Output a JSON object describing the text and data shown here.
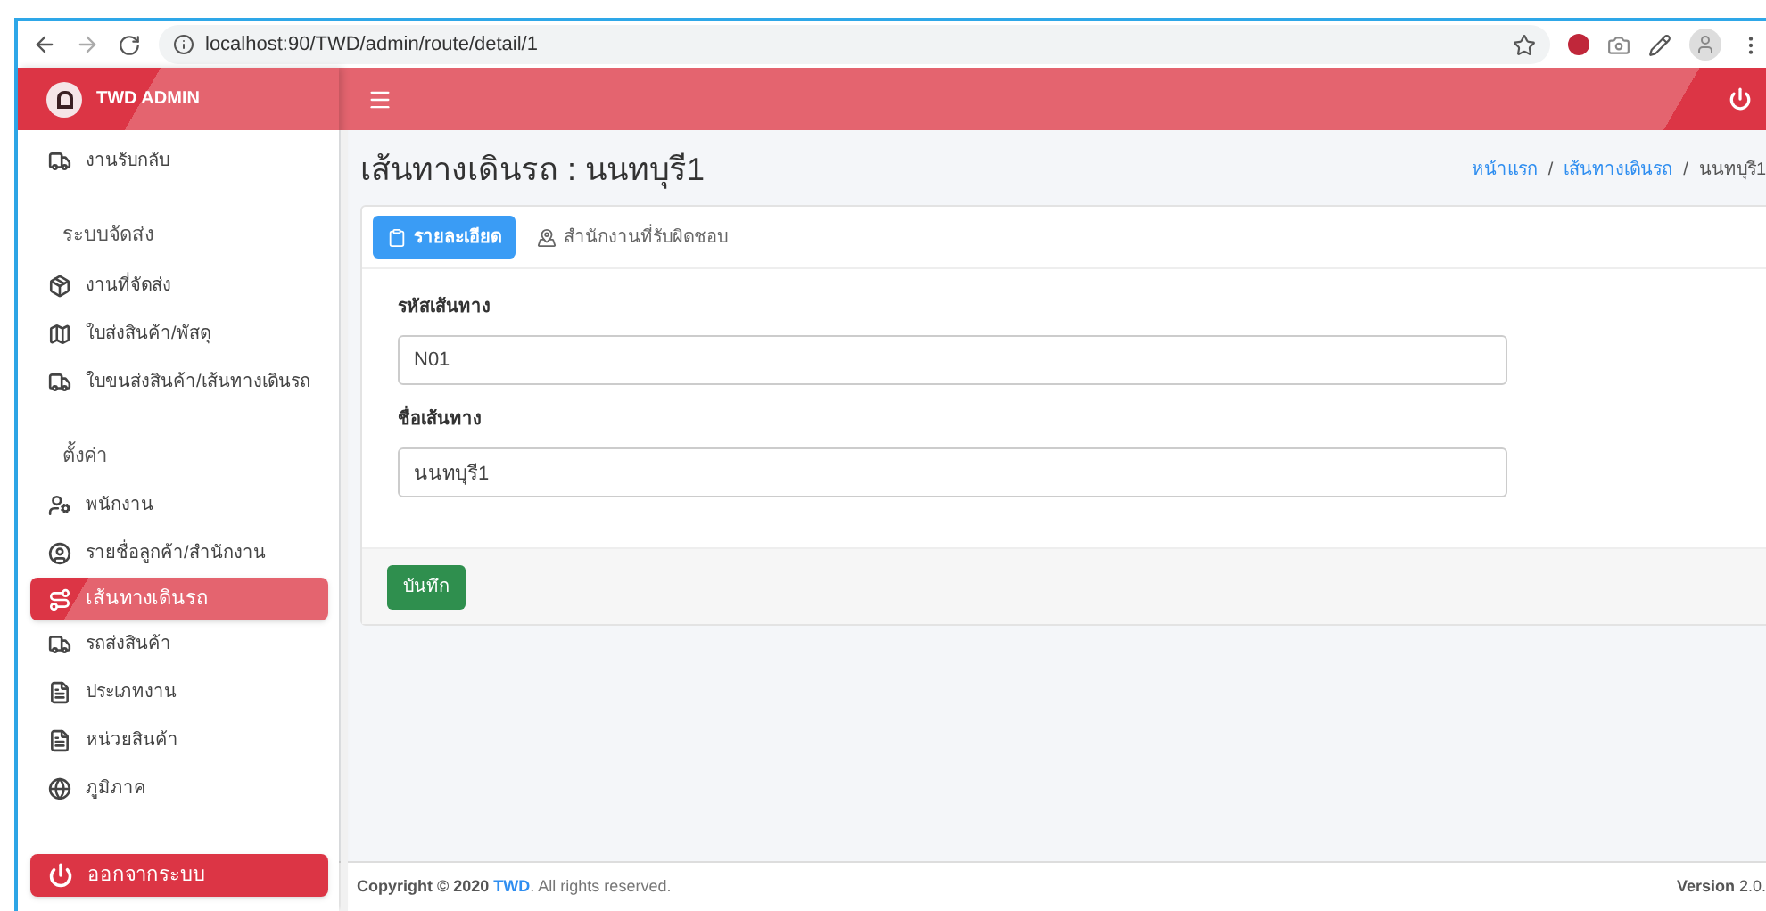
{
  "browser": {
    "url": "localhost:90/TWD/admin/route/detail/1"
  },
  "brand": {
    "title": "TWD ADMIN"
  },
  "sidebar": {
    "items": [
      {
        "kind": "item",
        "label": "งานรับกลับ",
        "selected": false
      },
      {
        "kind": "header",
        "label": "ระบบจัดส่ง"
      },
      {
        "kind": "item",
        "label": "งานที่จัดส่ง",
        "selected": false
      },
      {
        "kind": "item",
        "label": "ใบส่งสินค้า/พัสดุ",
        "selected": false
      },
      {
        "kind": "item",
        "label": "ใบขนส่งสินค้า/เส้นทางเดินรถ",
        "selected": false
      },
      {
        "kind": "header",
        "label": "ตั้งค่า"
      },
      {
        "kind": "item",
        "label": "พนักงาน",
        "selected": false
      },
      {
        "kind": "item",
        "label": "รายชื่อลูกค้า/สำนักงาน",
        "selected": false
      },
      {
        "kind": "item",
        "label": "เส้นทางเดินรถ",
        "selected": true
      },
      {
        "kind": "item",
        "label": "รถส่งสินค้า",
        "selected": false
      },
      {
        "kind": "item",
        "label": "ประเภทงาน",
        "selected": false
      },
      {
        "kind": "item",
        "label": "หน่วยสินค้า",
        "selected": false
      },
      {
        "kind": "item",
        "label": "ภูมิภาค",
        "selected": false
      }
    ],
    "logout": "ออกจากระบบ"
  },
  "page": {
    "title": "เส้นทางเดินรถ : นนทบุรี1",
    "breadcrumb": [
      {
        "label": "หน้าแรก",
        "link": true
      },
      {
        "label": "/",
        "link": false
      },
      {
        "label": "เส้นทางเดินรถ",
        "link": true
      },
      {
        "label": "/",
        "link": false
      },
      {
        "label": "นนทบุรี1",
        "link": false
      }
    ],
    "tabs": [
      {
        "label": "รายละเอียด",
        "selected": true
      },
      {
        "label": "สำนักงานที่รับผิดชอบ",
        "selected": false
      }
    ],
    "fields": [
      {
        "label": "รหัสเส้นทาง",
        "value": "N01"
      },
      {
        "label": "ชื่อเส้นทาง",
        "value": "นนทบุรี1"
      }
    ],
    "save_button": "บันทึก"
  },
  "footer": {
    "copyright": "Copyright © 2020",
    "brand": "TWD",
    "rights": ". All rights reserved.",
    "version_label": "Version",
    "version": "2.0."
  }
}
